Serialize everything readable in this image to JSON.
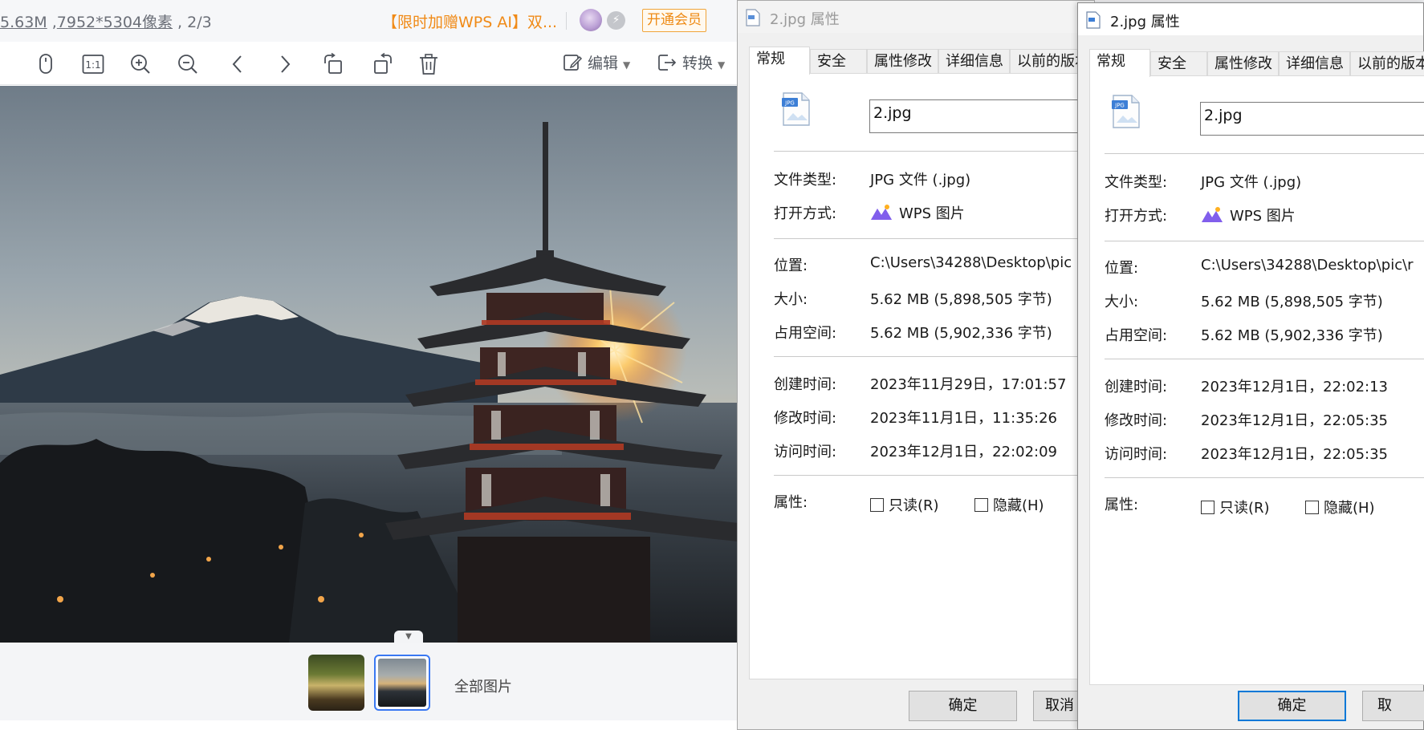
{
  "viewer": {
    "file_size": "5.63M",
    "file_sep": " ,",
    "dimensions": "7952*5304像素",
    "index": " , 2/3",
    "promo": "【限时加赠WPS AI】双...",
    "vip_button": "开通会员",
    "toolbar": {
      "edit_label": "编辑",
      "convert_label": "转换",
      "actual_size_label": "1:1"
    },
    "filmstrip": {
      "all_pictures": "全部图片"
    }
  },
  "dialogs": [
    {
      "title": "2.jpg 属性",
      "tabs": [
        "常规",
        "安全",
        "属性修改",
        "详细信息",
        "以前的版本"
      ],
      "active_tab": "常规",
      "filename": "2.jpg",
      "type_label": "文件类型:",
      "type_value": "JPG 文件 (.jpg)",
      "open_label": "打开方式:",
      "open_value": "WPS 图片",
      "location_label": "位置:",
      "location_value": "C:\\Users\\34288\\Desktop\\pic",
      "size_label": "大小:",
      "size_value": "5.62 MB (5,898,505 字节)",
      "disk_label": "占用空间:",
      "disk_value": "5.62 MB (5,902,336 字节)",
      "created_label": "创建时间:",
      "created_value": "2023年11月29日，17:01:57",
      "modified_label": "修改时间:",
      "modified_value": "2023年11月1日，11:35:26",
      "accessed_label": "访问时间:",
      "accessed_value": "2023年12月1日，22:02:09",
      "attr_label": "属性:",
      "readonly_label": "只读(R)",
      "hidden_label": "隐藏(H)",
      "ok_label": "确定",
      "cancel_label": "取消"
    },
    {
      "title": "2.jpg 属性",
      "tabs": [
        "常规",
        "安全",
        "属性修改",
        "详细信息",
        "以前的版本"
      ],
      "active_tab": "常规",
      "filename": "2.jpg",
      "type_label": "文件类型:",
      "type_value": "JPG 文件 (.jpg)",
      "open_label": "打开方式:",
      "open_value": "WPS 图片",
      "location_label": "位置:",
      "location_value": "C:\\Users\\34288\\Desktop\\pic\\r",
      "size_label": "大小:",
      "size_value": "5.62 MB (5,898,505 字节)",
      "disk_label": "占用空间:",
      "disk_value": "5.62 MB (5,902,336 字节)",
      "created_label": "创建时间:",
      "created_value": "2023年12月1日，22:02:13",
      "modified_label": "修改时间:",
      "modified_value": "2023年12月1日，22:05:35",
      "accessed_label": "访问时间:",
      "accessed_value": "2023年12月1日，22:05:35",
      "attr_label": "属性:",
      "readonly_label": "只读(R)",
      "hidden_label": "隐藏(H)",
      "ok_label": "确定",
      "cancel_label": "取"
    }
  ],
  "colors": {
    "accent": "#0078d7",
    "promo": "#f08a17",
    "thumb_selected": "#3a78f2"
  },
  "icons": {
    "mouse": "mouse-icon",
    "actual_size": "actual-size-icon",
    "zoom_in": "zoom-in-icon",
    "zoom_out": "zoom-out-icon",
    "prev": "chevron-left-icon",
    "next": "chevron-right-icon",
    "rotate_left": "rotate-left-icon",
    "rotate_right": "rotate-right-icon",
    "delete": "trash-icon",
    "edit": "edit-icon",
    "convert": "convert-icon",
    "file": "jpg-file-icon",
    "wps": "wps-pictures-icon"
  }
}
